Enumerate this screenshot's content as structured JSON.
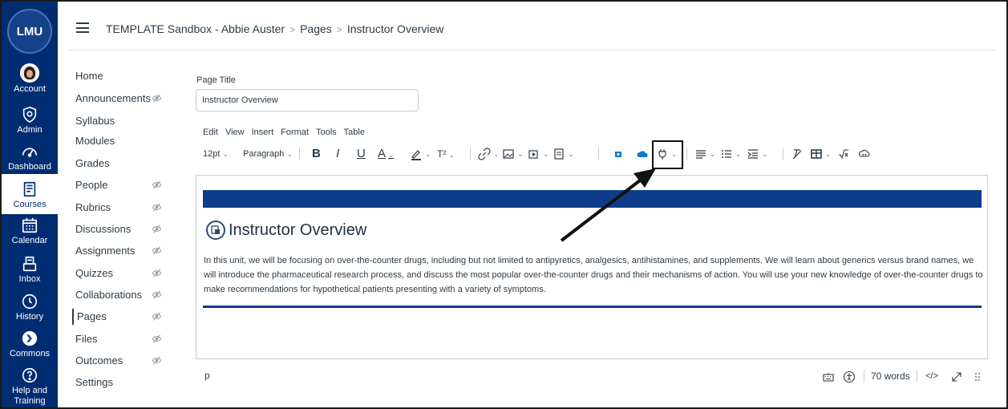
{
  "global_nav": {
    "logo_text": "LMU",
    "items": [
      {
        "label": "Account",
        "icon": "avatar"
      },
      {
        "label": "Admin",
        "icon": "shield-icon"
      },
      {
        "label": "Dashboard",
        "icon": "dashboard-icon"
      },
      {
        "label": "Courses",
        "icon": "book-icon"
      },
      {
        "label": "Calendar",
        "icon": "calendar-icon"
      },
      {
        "label": "Inbox",
        "icon": "inbox-icon"
      },
      {
        "label": "History",
        "icon": "clock-icon"
      },
      {
        "label": "Commons",
        "icon": "commons-icon"
      },
      {
        "label": "Help and Training",
        "icon": "help-icon"
      }
    ],
    "active": "Courses",
    "colors": {
      "bg": "#002D72",
      "active_bg": "#ffffff"
    }
  },
  "breadcrumb": {
    "course": "TEMPLATE Sandbox - Abbie Auster",
    "section": "Pages",
    "page": "Instructor Overview",
    "separator": ">"
  },
  "course_nav": {
    "items": [
      {
        "label": "Home",
        "hidden": false
      },
      {
        "label": "Announcements",
        "hidden": true
      },
      {
        "label": "Syllabus",
        "hidden": false
      },
      {
        "label": "Modules",
        "hidden": false
      },
      {
        "label": "Grades",
        "hidden": false
      },
      {
        "label": "People",
        "hidden": true
      },
      {
        "label": "Rubrics",
        "hidden": true
      },
      {
        "label": "Discussions",
        "hidden": true
      },
      {
        "label": "Assignments",
        "hidden": true
      },
      {
        "label": "Quizzes",
        "hidden": true
      },
      {
        "label": "Collaborations",
        "hidden": true
      },
      {
        "label": "Pages",
        "hidden": true
      },
      {
        "label": "Files",
        "hidden": true
      },
      {
        "label": "Outcomes",
        "hidden": true
      },
      {
        "label": "Settings",
        "hidden": false
      }
    ],
    "active": "Pages"
  },
  "editor": {
    "title_label": "Page Title",
    "title_value": "Instructor Overview",
    "menubar": [
      "Edit",
      "View",
      "Insert",
      "Format",
      "Tools",
      "Table"
    ],
    "toolbar": {
      "font_size": "12pt",
      "block_format": "Paragraph",
      "bold": "B",
      "italic": "I",
      "underline": "U",
      "text_color": "A",
      "superscript": "T²"
    },
    "content": {
      "heading": "Instructor Overview",
      "paragraph": "In this unit, we will be focusing on over-the-counter drugs, including but not limited to antipyretics, analgesics, antihistamines, and supplements. We will learn about generics versus brand names, we will introduce the pharmaceutical research process, and discuss the most popular over-the-counter drugs and their mechanisms of action. You will use your new knowledge of over-the-counter drugs to make recommendations for hypothetical patients presenting with a variety of symptoms.",
      "accent_color": "#0f3c8a"
    },
    "status": {
      "element_path": "p",
      "word_count": "70 words",
      "html_toggle": "</>"
    }
  }
}
